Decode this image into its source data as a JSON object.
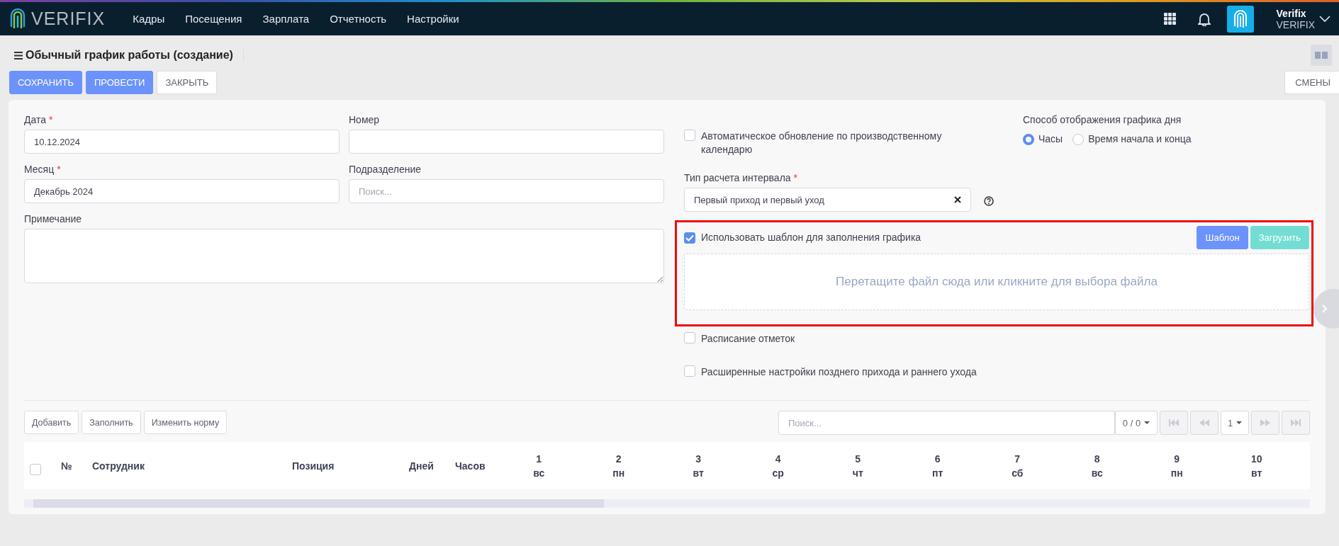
{
  "topbar": {
    "logo": "VERIFIX",
    "nav": [
      {
        "label": "Кадры"
      },
      {
        "label": "Посещения"
      },
      {
        "label": "Зарплата"
      },
      {
        "label": "Отчетность"
      },
      {
        "label": "Настройки"
      }
    ],
    "user": {
      "name": "Verifix",
      "company": "VERIFIX"
    }
  },
  "page": {
    "title": "Обычный график работы (создание)"
  },
  "actions": [
    {
      "label": "СОХРАНИТЬ",
      "kind": "primary"
    },
    {
      "label": "ПРОВЕСТИ",
      "kind": "primary"
    },
    {
      "label": "ЗАКРЫТЬ",
      "kind": "default"
    }
  ],
  "side_action": "СМЕНЫ",
  "form": {
    "fields": [
      {
        "label": "Дата",
        "marker": "*",
        "value": "10.12.2024"
      },
      {
        "label": "Номер"
      },
      {
        "label": "Месяц",
        "marker": "*",
        "value": "Декабрь 2024"
      },
      {
        "label": "Подразделение",
        "placeholder": "Поиск..."
      }
    ],
    "note": {
      "label": "Примечание"
    },
    "auto_update": {
      "label": "Автоматическое обновление по производственному календарю",
      "checked": false
    },
    "interval_type": {
      "label": "Тип расчета интервала",
      "marker": "*",
      "value": "Первый приход и первый уход"
    },
    "display_mode": {
      "label": "Способ отображения графика дня",
      "options": [
        {
          "label": "Часы",
          "selected": true
        },
        {
          "label": "Время начала и конца",
          "selected": false
        }
      ]
    },
    "use_template": {
      "label": "Использовать шаблон для заполнения графика",
      "checked": true,
      "buttons": [
        {
          "label": "Шаблон",
          "kind": "primary"
        },
        {
          "label": "Загрузить",
          "kind": "teal"
        }
      ],
      "dropzone": "Перетащите файл сюда или кликните для выбора файла"
    },
    "options": [
      {
        "label": "Расписание отметок",
        "checked": false
      },
      {
        "label": "Расширенные настройки позднего прихода и раннего ухода",
        "checked": false
      }
    ]
  },
  "table": {
    "buttons": [
      "Добавить",
      "Заполнить",
      "Изменить норму"
    ],
    "search_placeholder": "Поиск...",
    "counter": "0 / 0",
    "page": "1",
    "columns": [
      "№",
      "Сотрудник",
      "Позиция",
      "Дней",
      "Часов"
    ],
    "days": [
      {
        "day": "1",
        "weekday": "вс"
      },
      {
        "day": "2",
        "weekday": "пн"
      },
      {
        "day": "3",
        "weekday": "вт"
      },
      {
        "day": "4",
        "weekday": "ср"
      },
      {
        "day": "5",
        "weekday": "чт"
      },
      {
        "day": "6",
        "weekday": "пт"
      },
      {
        "day": "7",
        "weekday": "сб"
      },
      {
        "day": "8",
        "weekday": "вс"
      },
      {
        "day": "9",
        "weekday": "пн"
      },
      {
        "day": "10",
        "weekday": "вт"
      }
    ],
    "all_selected": false
  }
}
